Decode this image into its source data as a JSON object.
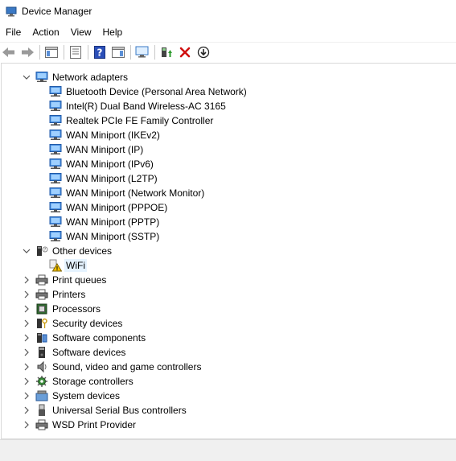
{
  "window": {
    "title": "Device Manager"
  },
  "menu": [
    {
      "label": "File"
    },
    {
      "label": "Action"
    },
    {
      "label": "View"
    },
    {
      "label": "Help"
    }
  ],
  "toolbar": {
    "icons": [
      "back-icon",
      "forward-icon",
      "show-hide-tree-icon",
      "properties-icon",
      "help-icon",
      "action-pane-icon",
      "scan-hardware-icon",
      "update-driver-icon",
      "uninstall-icon",
      "download-icon"
    ]
  },
  "tree": [
    {
      "label": "Network adapters",
      "level": 0,
      "expanded": true,
      "icon": "network-adapter-icon"
    },
    {
      "label": "Bluetooth Device (Personal Area Network)",
      "level": 1,
      "icon": "network-adapter-icon"
    },
    {
      "label": "Intel(R) Dual Band Wireless-AC 3165",
      "level": 1,
      "icon": "network-adapter-icon"
    },
    {
      "label": "Realtek PCIe FE Family Controller",
      "level": 1,
      "icon": "network-adapter-icon"
    },
    {
      "label": "WAN Miniport (IKEv2)",
      "level": 1,
      "icon": "network-adapter-icon"
    },
    {
      "label": "WAN Miniport (IP)",
      "level": 1,
      "icon": "network-adapter-icon"
    },
    {
      "label": "WAN Miniport (IPv6)",
      "level": 1,
      "icon": "network-adapter-icon"
    },
    {
      "label": "WAN Miniport (L2TP)",
      "level": 1,
      "icon": "network-adapter-icon"
    },
    {
      "label": "WAN Miniport (Network Monitor)",
      "level": 1,
      "icon": "network-adapter-icon"
    },
    {
      "label": "WAN Miniport (PPPOE)",
      "level": 1,
      "icon": "network-adapter-icon"
    },
    {
      "label": "WAN Miniport (PPTP)",
      "level": 1,
      "icon": "network-adapter-icon"
    },
    {
      "label": "WAN Miniport (SSTP)",
      "level": 1,
      "icon": "network-adapter-icon"
    },
    {
      "label": "Other devices",
      "level": 0,
      "expanded": true,
      "icon": "other-devices-icon"
    },
    {
      "label": "WiFi",
      "level": 1,
      "icon": "warning-device-icon",
      "selected": true
    },
    {
      "label": "Print queues",
      "level": 0,
      "expanded": false,
      "icon": "printer-icon"
    },
    {
      "label": "Printers",
      "level": 0,
      "expanded": false,
      "icon": "printer-icon"
    },
    {
      "label": "Processors",
      "level": 0,
      "expanded": false,
      "icon": "processor-icon"
    },
    {
      "label": "Security devices",
      "level": 0,
      "expanded": false,
      "icon": "security-key-icon"
    },
    {
      "label": "Software components",
      "level": 0,
      "expanded": false,
      "icon": "software-component-icon"
    },
    {
      "label": "Software devices",
      "level": 0,
      "expanded": false,
      "icon": "software-device-icon"
    },
    {
      "label": "Sound, video and game controllers",
      "level": 0,
      "expanded": false,
      "icon": "speaker-icon"
    },
    {
      "label": "Storage controllers",
      "level": 0,
      "expanded": false,
      "icon": "storage-controller-icon"
    },
    {
      "label": "System devices",
      "level": 0,
      "expanded": false,
      "icon": "system-device-icon"
    },
    {
      "label": "Universal Serial Bus controllers",
      "level": 0,
      "expanded": false,
      "icon": "usb-icon"
    },
    {
      "label": "WSD Print Provider",
      "level": 0,
      "expanded": false,
      "icon": "printer-icon"
    }
  ]
}
